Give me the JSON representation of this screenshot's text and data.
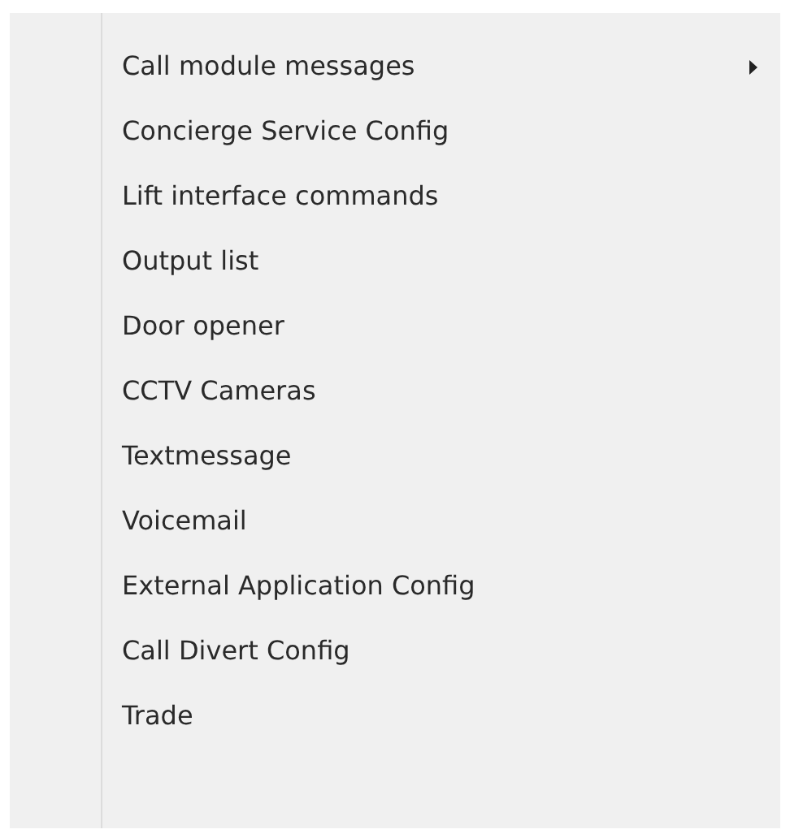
{
  "menu": {
    "items": [
      {
        "label": "Call module messages",
        "has_submenu": true
      },
      {
        "label": "Concierge Service Config",
        "has_submenu": false
      },
      {
        "label": "Lift interface commands",
        "has_submenu": false
      },
      {
        "label": "Output list",
        "has_submenu": false
      },
      {
        "label": "Door opener",
        "has_submenu": false
      },
      {
        "label": "CCTV Cameras",
        "has_submenu": false
      },
      {
        "label": "Textmessage",
        "has_submenu": false
      },
      {
        "label": "Voicemail",
        "has_submenu": false
      },
      {
        "label": "External Application Config",
        "has_submenu": false
      },
      {
        "label": "Call Divert Config",
        "has_submenu": false
      },
      {
        "label": "Trade",
        "has_submenu": false
      }
    ]
  }
}
